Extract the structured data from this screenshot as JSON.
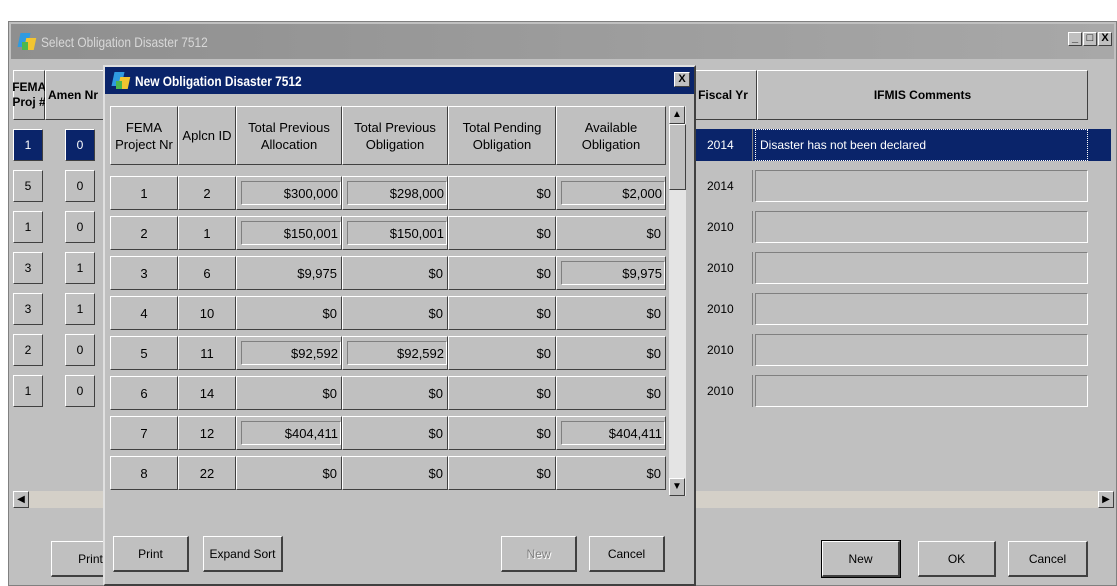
{
  "outer_window": {
    "title": "Select Obligation  Disaster 7512",
    "controls": {
      "minimize": "_",
      "maximize": "□",
      "close": "X"
    },
    "columns": {
      "fema_proj": "FEMA Proj #",
      "amend_nr": "Amen Nr",
      "fiscal_yr": "Fiscal Yr",
      "ifmis_comments": "IFMIS Comments"
    },
    "rows": [
      {
        "fema_proj": "1",
        "amend_nr": "0",
        "fiscal_yr": "2014",
        "comment": "Disaster has not been declared"
      },
      {
        "fema_proj": "5",
        "amend_nr": "0",
        "fiscal_yr": "2014",
        "comment": ""
      },
      {
        "fema_proj": "1",
        "amend_nr": "0",
        "fiscal_yr": "2010",
        "comment": ""
      },
      {
        "fema_proj": "3",
        "amend_nr": "1",
        "fiscal_yr": "2010",
        "comment": ""
      },
      {
        "fema_proj": "3",
        "amend_nr": "1",
        "fiscal_yr": "2010",
        "comment": ""
      },
      {
        "fema_proj": "2",
        "amend_nr": "0",
        "fiscal_yr": "2010",
        "comment": ""
      },
      {
        "fema_proj": "1",
        "amend_nr": "0",
        "fiscal_yr": "2010",
        "comment": ""
      }
    ],
    "selected_row": 0,
    "buttons": {
      "print": "Print",
      "new": "New",
      "ok": "OK",
      "cancel": "Cancel"
    }
  },
  "inner_dialog": {
    "title": "New Obligation  Disaster 7512",
    "close": "X",
    "columns": {
      "fema_project_nr": "FEMA\nProject Nr",
      "aplcn_id": "Aplcn ID",
      "total_prev_allocation": "Total Previous\nAllocation",
      "total_prev_obligation": "Total Previous\nObligation",
      "total_pending_obligation": "Total Pending\nObligation",
      "available_obligation": "Available\nObligation"
    },
    "rows": [
      {
        "proj": "1",
        "aplcn": "2",
        "alloc": "$300,000",
        "prev_obl": "$298,000",
        "pending": "$0",
        "avail": "$2,000"
      },
      {
        "proj": "2",
        "aplcn": "1",
        "alloc": "$150,001",
        "prev_obl": "$150,001",
        "pending": "$0",
        "avail": "$0"
      },
      {
        "proj": "3",
        "aplcn": "6",
        "alloc": "$9,975",
        "prev_obl": "$0",
        "pending": "$0",
        "avail": "$9,975"
      },
      {
        "proj": "4",
        "aplcn": "10",
        "alloc": "$0",
        "prev_obl": "$0",
        "pending": "$0",
        "avail": "$0"
      },
      {
        "proj": "5",
        "aplcn": "11",
        "alloc": "$92,592",
        "prev_obl": "$92,592",
        "pending": "$0",
        "avail": "$0"
      },
      {
        "proj": "6",
        "aplcn": "14",
        "alloc": "$0",
        "prev_obl": "$0",
        "pending": "$0",
        "avail": "$0"
      },
      {
        "proj": "7",
        "aplcn": "12",
        "alloc": "$404,411",
        "prev_obl": "$0",
        "pending": "$0",
        "avail": "$404,411"
      },
      {
        "proj": "8",
        "aplcn": "22",
        "alloc": "$0",
        "prev_obl": "$0",
        "pending": "$0",
        "avail": "$0"
      }
    ],
    "buttons": {
      "print": "Print",
      "expand_sort": "Expand Sort",
      "new": "New",
      "cancel": "Cancel"
    }
  },
  "colors": {
    "window_bg": "#c0c0c0",
    "active_title": "#0a246a",
    "inactive_title": "#a0a0a0",
    "selection": "#0a246a"
  }
}
